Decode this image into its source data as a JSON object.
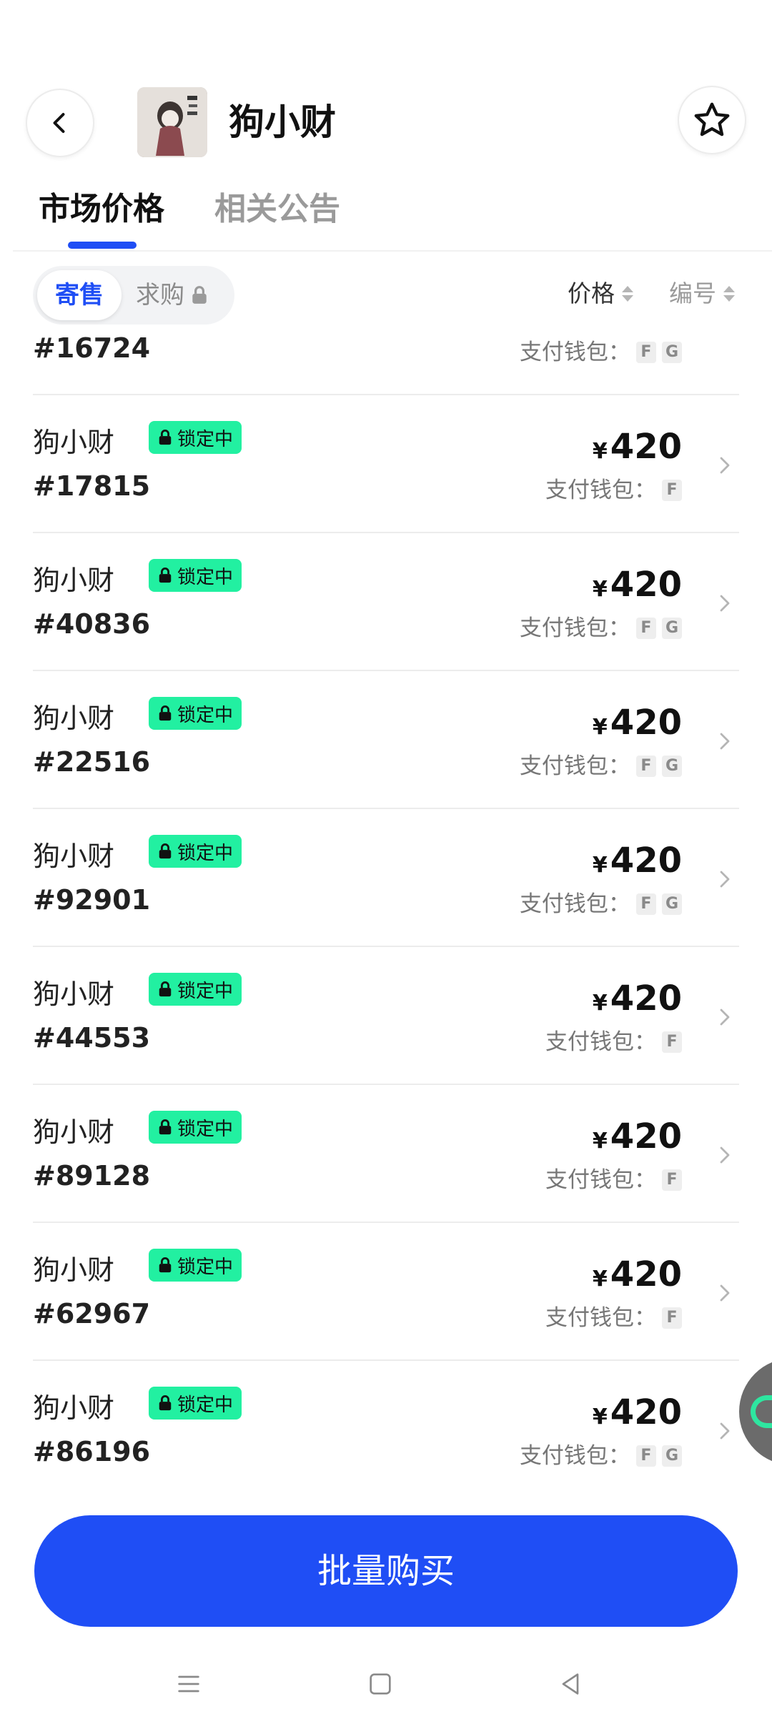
{
  "header": {
    "title": "狗小财",
    "back_icon": "chevron-left-icon",
    "favorite_icon": "star-outline-icon"
  },
  "tabs": [
    {
      "label": "市场价格",
      "active": true
    },
    {
      "label": "相关公告",
      "active": false
    }
  ],
  "filters": {
    "segment_sell": "寄售",
    "segment_buy": "求购",
    "sort_price": "价格",
    "sort_number": "编号"
  },
  "list": {
    "wallet_label": "支付钱包：",
    "currency": "¥",
    "lock_label": "锁定中",
    "partial_row": {
      "id": "#16724",
      "wallets": [
        "F",
        "G"
      ]
    },
    "rows": [
      {
        "name": "狗小财",
        "id": "#17815",
        "price": "420",
        "wallets": [
          "F"
        ]
      },
      {
        "name": "狗小财",
        "id": "#40836",
        "price": "420",
        "wallets": [
          "F",
          "G"
        ]
      },
      {
        "name": "狗小财",
        "id": "#22516",
        "price": "420",
        "wallets": [
          "F",
          "G"
        ]
      },
      {
        "name": "狗小财",
        "id": "#92901",
        "price": "420",
        "wallets": [
          "F",
          "G"
        ]
      },
      {
        "name": "狗小财",
        "id": "#44553",
        "price": "420",
        "wallets": [
          "F"
        ]
      },
      {
        "name": "狗小财",
        "id": "#89128",
        "price": "420",
        "wallets": [
          "F"
        ]
      },
      {
        "name": "狗小财",
        "id": "#62967",
        "price": "420",
        "wallets": [
          "F"
        ]
      },
      {
        "name": "狗小财",
        "id": "#86196",
        "price": "420",
        "wallets": [
          "F",
          "G"
        ]
      }
    ]
  },
  "actions": {
    "bulk_buy": "批量购买"
  },
  "colors": {
    "accent": "#1f4ef5",
    "lock_badge": "#22f0a1"
  }
}
